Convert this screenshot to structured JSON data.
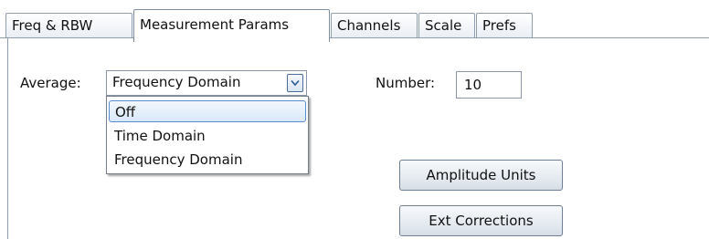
{
  "tabs": [
    {
      "label": "Freq & RBW",
      "active": false
    },
    {
      "label": "Measurement Params",
      "active": true
    },
    {
      "label": "Channels",
      "active": false
    },
    {
      "label": "Scale",
      "active": false
    },
    {
      "label": "Prefs",
      "active": false
    }
  ],
  "average": {
    "label": "Average:",
    "selected": "Frequency Domain",
    "options": [
      "Off",
      "Time Domain",
      "Frequency Domain"
    ],
    "highlighted_option": "Off"
  },
  "number": {
    "label": "Number:",
    "value": "10"
  },
  "buttons": {
    "amplitude_units": "Amplitude Units",
    "ext_corrections": "Ext Corrections"
  },
  "colors": {
    "border": "#8e9db0",
    "highlight": "#d8e8f8",
    "highlight_border": "#5b8ed0"
  },
  "icons": {
    "combo_arrow": "chevron-down-icon"
  }
}
